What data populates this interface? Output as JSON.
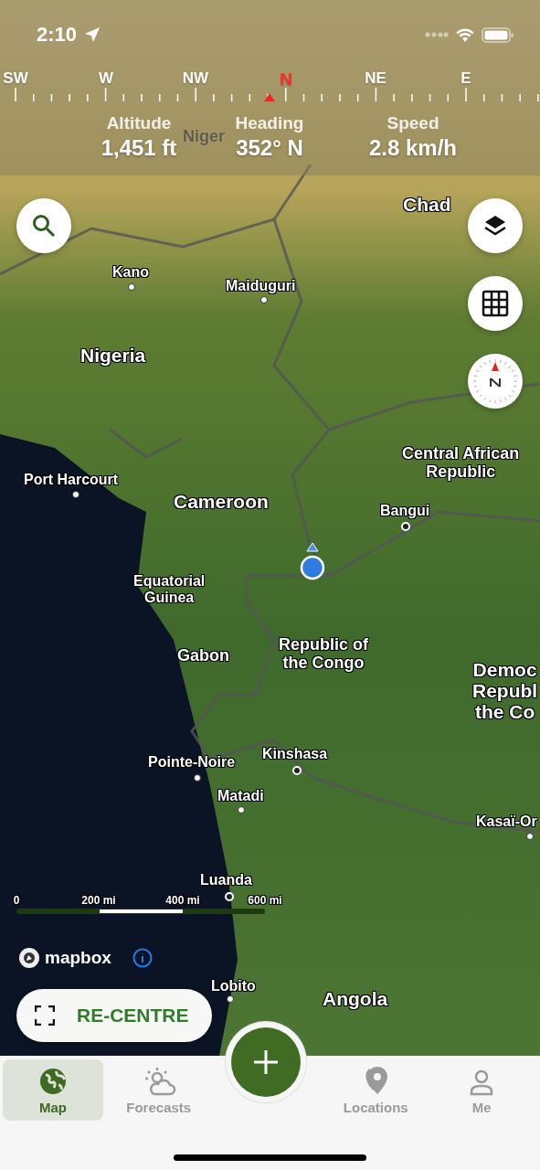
{
  "status_bar": {
    "time": "2:10"
  },
  "compass": {
    "labels": [
      {
        "text": "SW",
        "highlighted": false
      },
      {
        "text": "W",
        "highlighted": false
      },
      {
        "text": "NW",
        "highlighted": false
      },
      {
        "text": "N",
        "highlighted": true
      },
      {
        "text": "NE",
        "highlighted": false
      },
      {
        "text": "E",
        "highlighted": false
      }
    ]
  },
  "stats": [
    {
      "label": "Altitude",
      "value": "1,451 ft"
    },
    {
      "label": "Heading",
      "value": "352° N"
    },
    {
      "label": "Speed",
      "value": "2.8 km/h"
    }
  ],
  "map_labels": [
    {
      "lines": [
        "Niger"
      ],
      "kind": "faded"
    },
    {
      "lines": [
        "Chad"
      ],
      "kind": "country"
    },
    {
      "lines": [
        "Kano"
      ],
      "kind": "city"
    },
    {
      "lines": [
        "Maiduguri"
      ],
      "kind": "city"
    },
    {
      "lines": [
        "Nigeria"
      ],
      "kind": "country"
    },
    {
      "lines": [
        "Port Harcourt"
      ],
      "kind": "city"
    },
    {
      "lines": [
        "Central African",
        "Republic"
      ],
      "kind": "region"
    },
    {
      "lines": [
        "Cameroon"
      ],
      "kind": "country"
    },
    {
      "lines": [
        "Bangui"
      ],
      "kind": "capital"
    },
    {
      "lines": [
        "Equatorial",
        "Guinea"
      ],
      "kind": "small-region"
    },
    {
      "lines": [
        "Gabon"
      ],
      "kind": "region"
    },
    {
      "lines": [
        "Republic of",
        "the Congo"
      ],
      "kind": "region"
    },
    {
      "lines": [
        "Democ",
        "Republ",
        "the Co"
      ],
      "kind": "country"
    },
    {
      "lines": [
        "Pointe-Noire"
      ],
      "kind": "city"
    },
    {
      "lines": [
        "Kinshasa"
      ],
      "kind": "capital"
    },
    {
      "lines": [
        "Matadi"
      ],
      "kind": "city"
    },
    {
      "lines": [
        "Kasaï-Or"
      ],
      "kind": "city"
    },
    {
      "lines": [
        "Luanda"
      ],
      "kind": "capital"
    },
    {
      "lines": [
        "Lobito"
      ],
      "kind": "city"
    },
    {
      "lines": [
        "Angola"
      ],
      "kind": "country"
    }
  ],
  "scale_bar": {
    "ticks": [
      "0",
      "200 mi",
      "400 mi",
      "600 mi"
    ]
  },
  "attribution": {
    "logo": "mapbox"
  },
  "recentre_button": {
    "label": "RE-CENTRE"
  },
  "tabs": [
    {
      "label": "Map",
      "kind": "map",
      "selected": true
    },
    {
      "label": "Forecasts",
      "kind": "forecasts",
      "selected": false
    },
    {
      "kind": "add"
    },
    {
      "label": "Locations",
      "kind": "locations",
      "selected": false
    },
    {
      "label": "Me",
      "kind": "me",
      "selected": false
    }
  ]
}
